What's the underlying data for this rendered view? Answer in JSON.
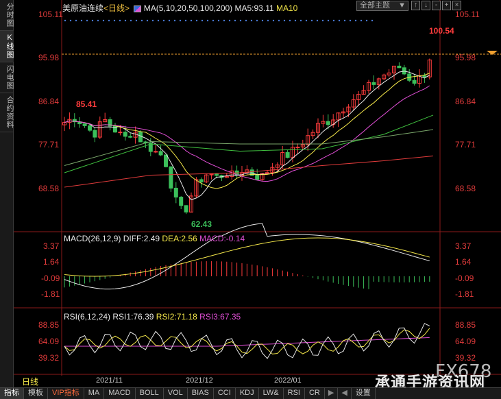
{
  "side_tabs": [
    "分时图",
    "K线图",
    "闪电图",
    "合约资料"
  ],
  "header": {
    "instrument": "美原油连续",
    "period_tag": "<日线>",
    "ma_label": "MA(5,10,20,50,100,200)",
    "ma5": "MA5:93.11",
    "ma10": "MA10",
    "theme": "全部主题",
    "theme_arrow": "▼",
    "buttons": [
      "↑",
      "↓",
      "-",
      "+",
      "×"
    ]
  },
  "price_axis": [
    "105.11",
    "95.98",
    "86.84",
    "77.71",
    "68.58"
  ],
  "annotations": {
    "high": "100.54",
    "left_high": "85.41",
    "low": "62.43"
  },
  "macd": {
    "label": "MACD(26,12,9)",
    "diff": "DIFF:2.49",
    "dea": "DEA:2.56",
    "macd": "MACD:-0.14",
    "axis": [
      "3.37",
      "1.64",
      "-0.09",
      "-1.81"
    ]
  },
  "rsi": {
    "label": "RSI(6,12,24)",
    "rsi1": "RSI1:76.39",
    "rsi2": "RSI2:71.18",
    "rsi3": "RSI3:67.35",
    "axis": [
      "88.85",
      "64.09",
      "39.32"
    ]
  },
  "date_axis": [
    "2021/11",
    "2021/12",
    "2022/01"
  ],
  "period_label": "日线",
  "bottom_tabs": [
    "指标",
    "模板",
    "VIP指标",
    "MA",
    "MACD",
    "BOLL",
    "VOL",
    "BIAS",
    "CCI",
    "KDJ",
    "LW&",
    "RSI",
    "CR",
    "设置"
  ],
  "bottom_arrows": [
    "▶",
    "◀"
  ],
  "watermark": "承通手游资讯网",
  "fx_mark": "FX678",
  "colors": {
    "up": "#ff3c3c",
    "down": "#3bbf5a",
    "ma5": "#e8e8e8",
    "ma10": "#f5e84a",
    "ma20": "#e14fd6",
    "ma50": "#3fbf3f",
    "ma100": "#7aa66a",
    "ma200": "#e03b3b",
    "grid": "#8b1a1a"
  }
}
